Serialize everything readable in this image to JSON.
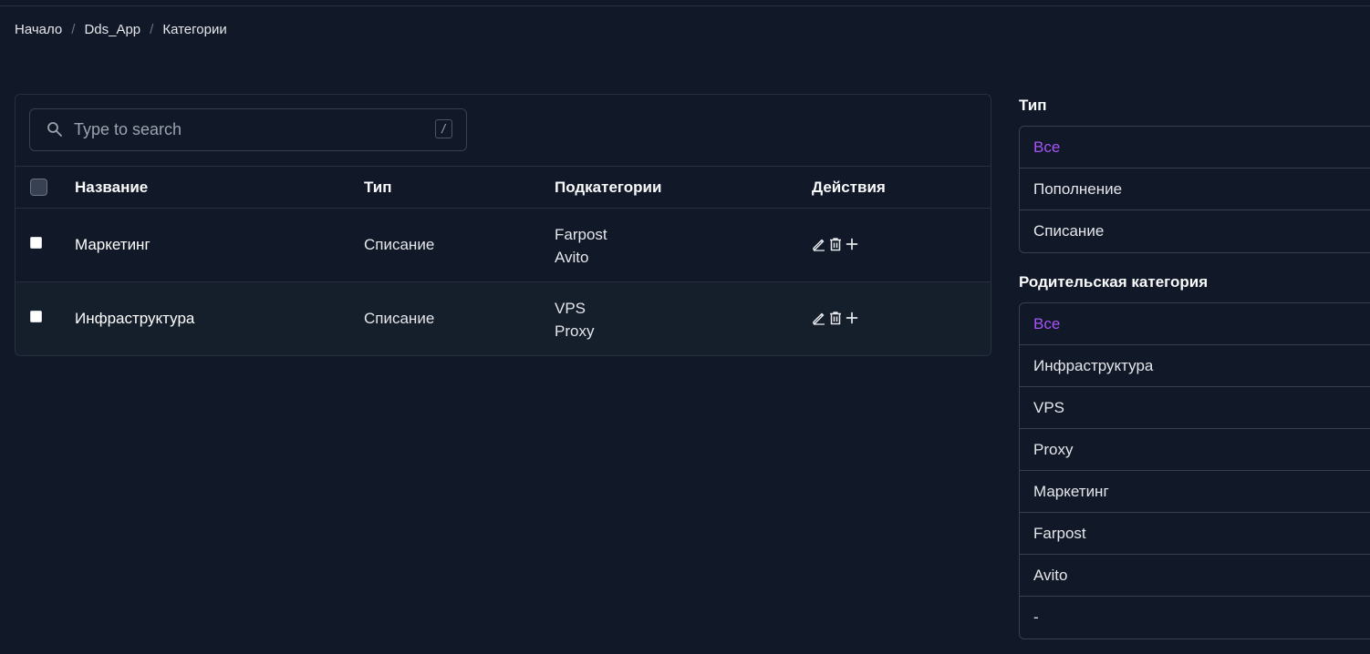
{
  "breadcrumb": {
    "items": [
      "Начало",
      "Dds_App",
      "Категории"
    ],
    "separator": "/"
  },
  "search": {
    "placeholder": "Type to search",
    "value": "",
    "shortcut": "/"
  },
  "table": {
    "headers": {
      "name": "Название",
      "type": "Тип",
      "subcategories": "Подкатегории",
      "actions": "Действия"
    },
    "rows": [
      {
        "name": "Маркетинг",
        "type": "Списание",
        "subcategories": [
          "Farpost",
          "Avito"
        ]
      },
      {
        "name": "Инфраструктура",
        "type": "Списание",
        "subcategories": [
          "VPS",
          "Proxy"
        ]
      }
    ],
    "row_actions": [
      "edit-icon",
      "trash-icon",
      "plus-icon"
    ]
  },
  "filters": {
    "type": {
      "title": "Тип",
      "options": [
        "Все",
        "Пополнение",
        "Списание"
      ],
      "selected": "Все"
    },
    "parent": {
      "title": "Родительская категория",
      "options": [
        "Все",
        "Инфраструктура",
        "VPS",
        "Proxy",
        "Маркетинг",
        "Farpost",
        "Avito",
        "-"
      ],
      "selected": "Все"
    }
  },
  "colors": {
    "background": "#111827",
    "accent": "#a855f7",
    "border": "#374151"
  }
}
